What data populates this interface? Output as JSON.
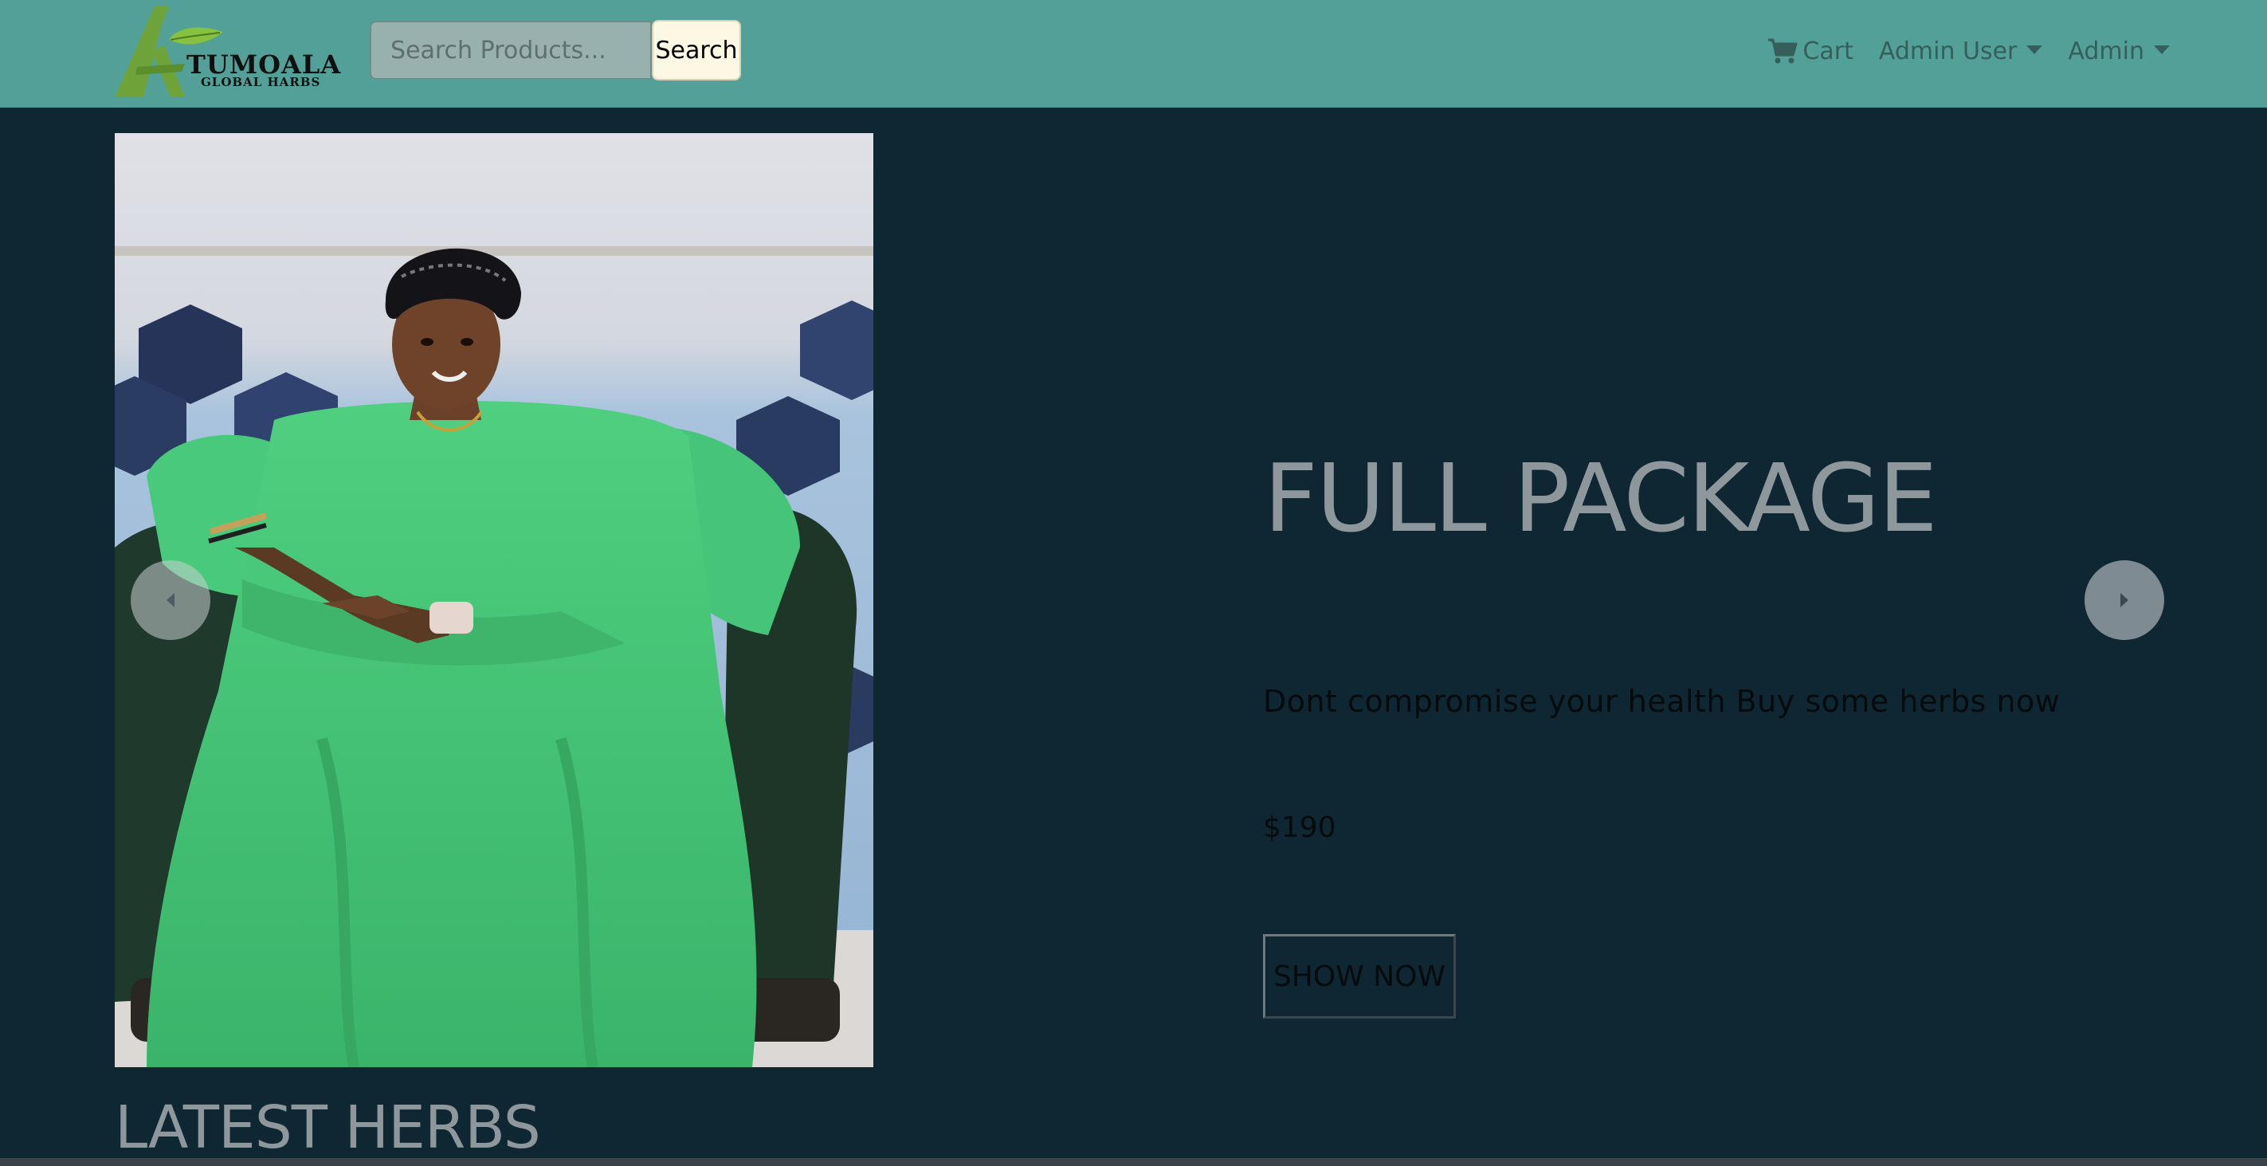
{
  "navbar": {
    "logo_text": "TUMOALA",
    "logo_subtext": "GLOBAL HARBS",
    "search_placeholder": "Search Products...",
    "search_button": "Search",
    "cart_label": "Cart",
    "user_menu_label": "Admin User",
    "admin_menu_label": "Admin"
  },
  "hero": {
    "title": "FULL PACKAGE",
    "description": "Dont compromise your health Buy some herbs now",
    "price": "$190",
    "button_label": "SHOW NOW"
  },
  "section": {
    "title": "LATEST HERBS"
  },
  "colors": {
    "navbar_bg": "#52a098",
    "page_bg": "#0f2733",
    "title_text": "#8e979c"
  }
}
